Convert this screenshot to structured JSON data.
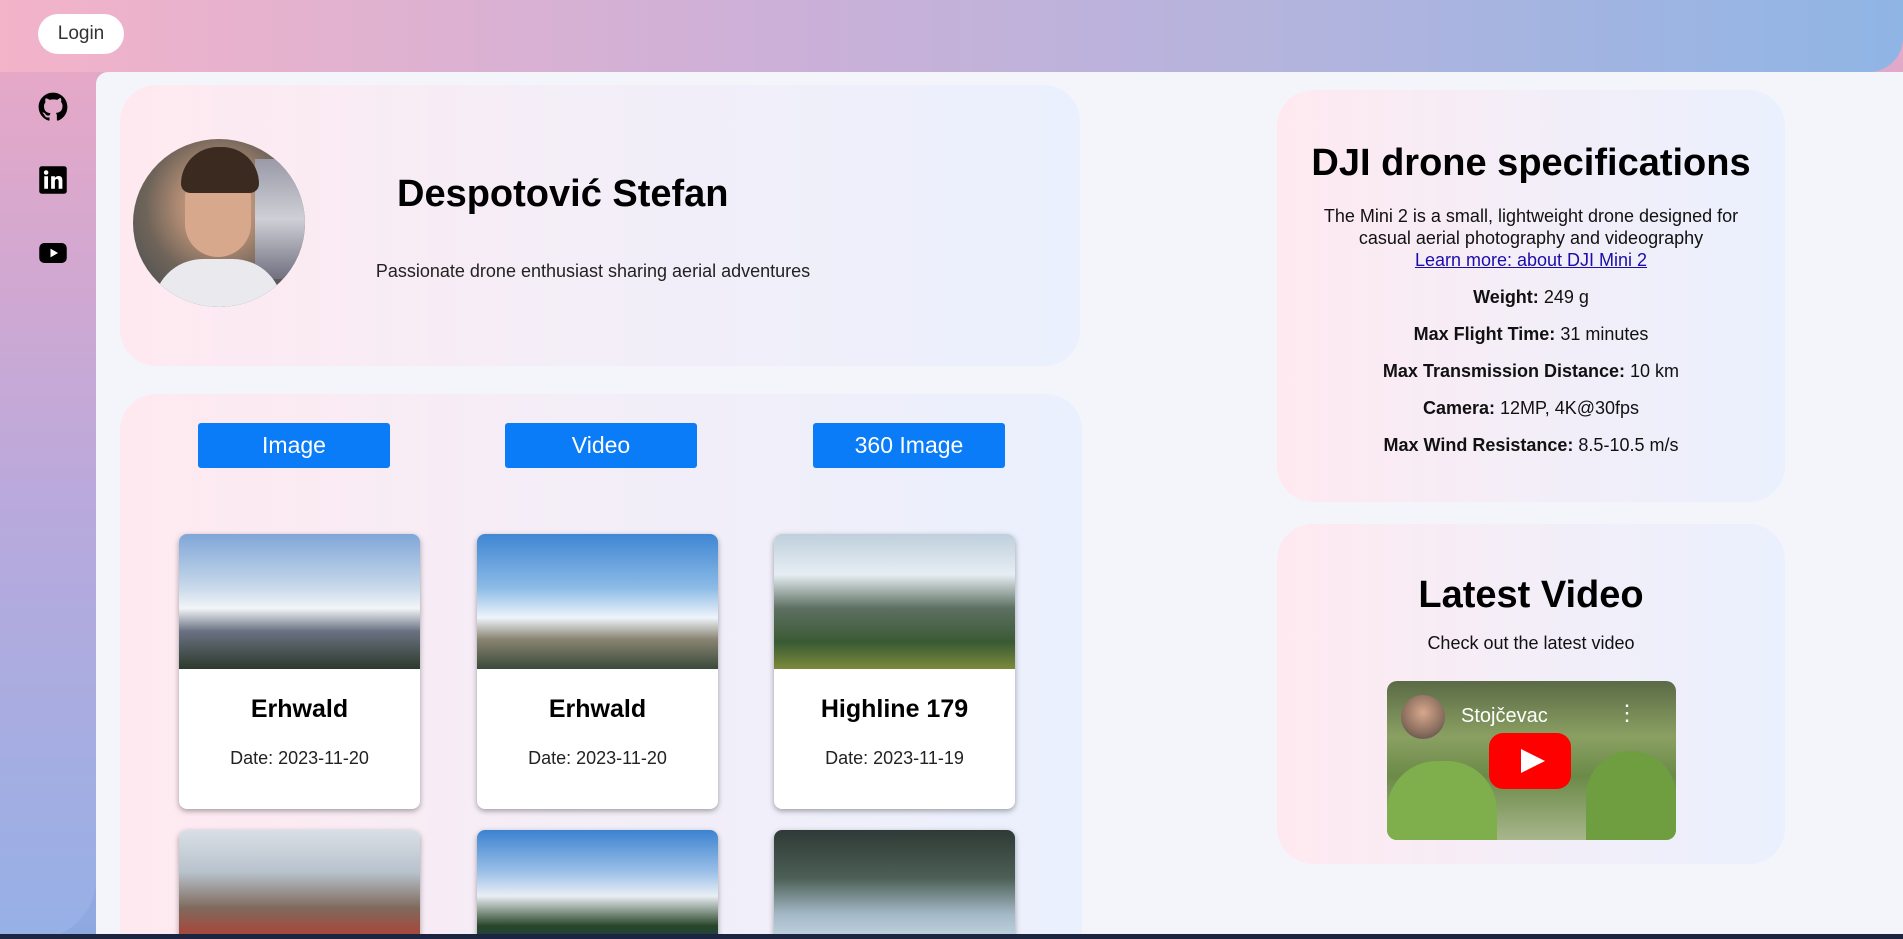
{
  "header": {
    "login_label": "Login"
  },
  "social": [
    {
      "name": "github-icon"
    },
    {
      "name": "linkedin-icon"
    },
    {
      "name": "youtube-icon"
    }
  ],
  "profile": {
    "name": "Despotović Stefan",
    "bio": "Passionate drone enthusiast sharing aerial adventures"
  },
  "tabs": [
    "Image",
    "Video",
    "360 Image"
  ],
  "gallery": {
    "items": [
      {
        "title": "Erhwald",
        "date": "Date: 2023-11-20"
      },
      {
        "title": "Erhwald",
        "date": "Date: 2023-11-20"
      },
      {
        "title": "Highline 179",
        "date": "Date: 2023-11-19"
      }
    ]
  },
  "specs": {
    "title": "DJI drone specifications",
    "description": "The Mini 2 is a small, lightweight drone designed for casual aerial photography and videography",
    "link_text": "Learn more: about DJI Mini 2",
    "rows": [
      {
        "label": "Weight:",
        "value": "249 g"
      },
      {
        "label": "Max Flight Time:",
        "value": "31 minutes"
      },
      {
        "label": "Max Transmission Distance:",
        "value": "10 km"
      },
      {
        "label": "Camera:",
        "value": "12MP, 4K@30fps"
      },
      {
        "label": "Max Wind Resistance:",
        "value": "8.5-10.5 m/s"
      }
    ]
  },
  "video": {
    "title": "Latest Video",
    "subtitle": "Check out the latest video",
    "channel_name": "Stojčevac"
  },
  "colors": {
    "accent": "#0a7cf8",
    "youtube_red": "#ff0000"
  }
}
